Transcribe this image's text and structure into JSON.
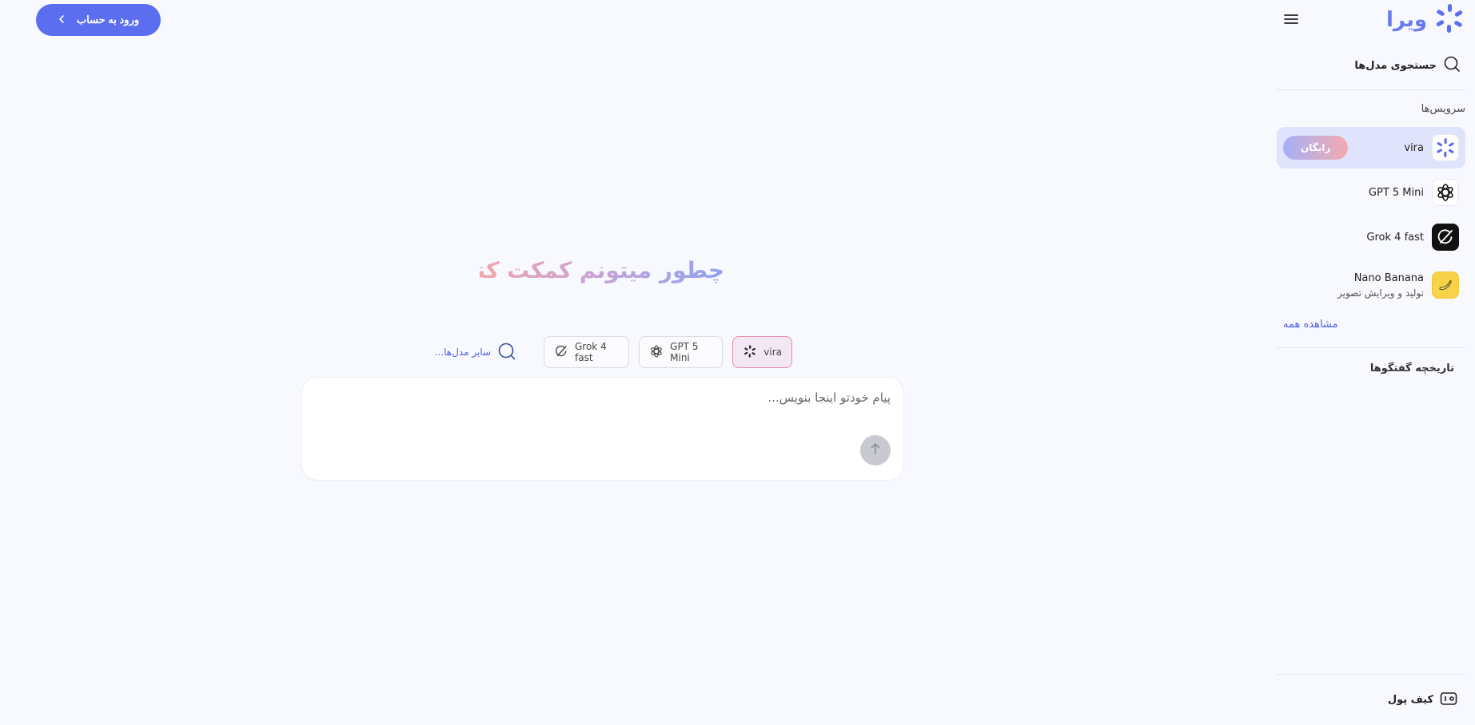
{
  "brand": {
    "wordmark": "ویرا",
    "accent": "#5c6ef0"
  },
  "header": {
    "login_label": "ورود به حساب"
  },
  "sidebar": {
    "search_label": "جستجوی مدل‌ها",
    "services_title": "سرویس‌ها",
    "services": [
      {
        "name": "vira",
        "badge": "رایگان",
        "icon": "vira-logo-icon",
        "active": true
      },
      {
        "name": "GPT 5 Mini",
        "icon": "openai-icon"
      },
      {
        "name": "Grok 4 fast",
        "icon": "grok-icon"
      },
      {
        "name": "Nano Banana",
        "subtitle": "تولید و ویرایش تصویر",
        "icon": "banana-icon"
      }
    ],
    "see_all_label": "مشاهده همه",
    "history_title": "تاریخچه گفتگوها",
    "wallet_label": "کیف پول"
  },
  "main": {
    "headline": "چطور میتونم کمکت کنم؟",
    "chips": [
      {
        "label": "vira",
        "icon": "vira-logo-icon",
        "selected": true
      },
      {
        "label": "GPT 5 Mini",
        "icon": "openai-icon"
      },
      {
        "label": "Grok 4 fast",
        "icon": "grok-icon"
      }
    ],
    "more_models_label": "سایر مدل‌ها...",
    "composer": {
      "placeholder": "پیام خودتو اینجا بنویس..."
    }
  }
}
